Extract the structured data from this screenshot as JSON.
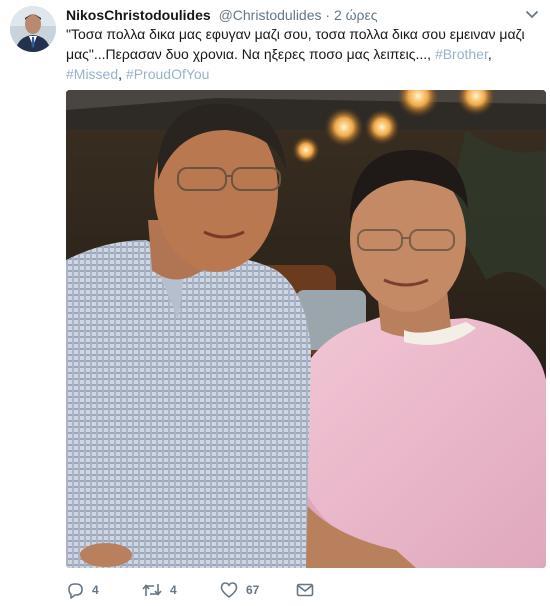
{
  "tweet": {
    "author_name": "NikosChristodoulides",
    "author_handle": "@Christodulides",
    "separator": "·",
    "time": "2 ώρες",
    "text_part1": "\"Τοσα πολλα δικα μας εφυγαν μαζι σου, τοσα πολλα δικα σου εμειναν μαζι μας\"...Περασαν δυο χρονια. Να ηξερες ποσο μας λειπεις...,",
    "hashtags": [
      "#Brother",
      "#Missed",
      "#ProudOfYou"
    ],
    "separator_comma": ","
  },
  "actions": {
    "reply_count": "4",
    "retweet_count": "4",
    "like_count": "67"
  },
  "icons": {
    "reply": "reply-icon",
    "retweet": "retweet-icon",
    "like": "heart-icon",
    "message": "envelope-icon",
    "caret": "chevron-down-icon"
  },
  "colors": {
    "hashtag": "#98b2cc",
    "meta": "#657786",
    "text": "#14171a"
  }
}
